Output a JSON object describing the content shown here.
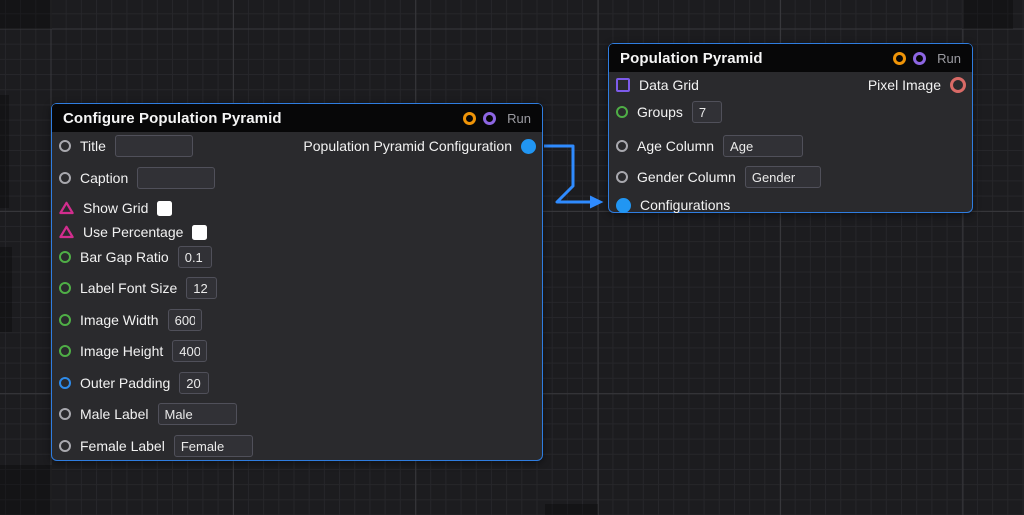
{
  "canvas": {
    "type": "node-graph-editor",
    "colors": {
      "canvas_background": "#1c1c1f",
      "grid_minor": "#26262a",
      "grid_major": "#38383c",
      "node_background": "#2a2a2d",
      "node_header": "#070708",
      "node_border": "#2f7de0",
      "wire": "#2f8bff",
      "port_gray": "#a8a8ae",
      "port_green": "#4fae46",
      "port_blue": "#2e8bea",
      "port_blue_filled": "#2196f3",
      "port_magenta": "#d22d8e",
      "port_orange": "#ef9408",
      "port_purple": "#8d66e3",
      "port_violet_square": "#7d5bea",
      "port_red": "#d96a66",
      "checkbox": "#ffffff"
    }
  },
  "nodes": [
    {
      "title": "Configure Population Pyramid",
      "run_label": "Run",
      "inputs": [
        {
          "label": "Title",
          "port": "gray-ring",
          "control": "text",
          "value": ""
        },
        {
          "label": "Caption",
          "port": "gray-ring",
          "control": "text",
          "value": ""
        },
        {
          "label": "Show Grid",
          "port": "magenta-triangle",
          "control": "checkbox",
          "checked": false
        },
        {
          "label": "Use Percentage",
          "port": "magenta-triangle",
          "control": "checkbox",
          "checked": false
        },
        {
          "label": "Bar Gap Ratio",
          "port": "green-ring",
          "control": "text",
          "value": "0.1"
        },
        {
          "label": "Label Font Size",
          "port": "green-ring",
          "control": "text",
          "value": "12"
        },
        {
          "label": "Image Width",
          "port": "green-ring",
          "control": "text",
          "value": "600"
        },
        {
          "label": "Image Height",
          "port": "green-ring",
          "control": "text",
          "value": "400"
        },
        {
          "label": "Outer Padding",
          "port": "blue-ring",
          "control": "text",
          "value": "20"
        },
        {
          "label": "Male Label",
          "port": "gray-ring",
          "control": "text",
          "value": "Male"
        },
        {
          "label": "Female Label",
          "port": "gray-ring",
          "control": "text",
          "value": "Female"
        }
      ],
      "outputs": [
        {
          "label": "Population Pyramid Configuration",
          "port": "blue-filled",
          "connected": true
        }
      ]
    },
    {
      "title": "Population Pyramid",
      "run_label": "Run",
      "inputs": [
        {
          "label": "Data Grid",
          "port": "violet-square",
          "control": "none"
        },
        {
          "label": "Groups",
          "port": "green-ring",
          "control": "text",
          "value": "7"
        },
        {
          "label": "Age Column",
          "port": "gray-ring",
          "control": "text",
          "value": "Age"
        },
        {
          "label": "Gender Column",
          "port": "gray-ring",
          "control": "text",
          "value": "Gender"
        },
        {
          "label": "Configurations",
          "port": "blue-filled",
          "control": "none",
          "connected": true
        }
      ],
      "outputs": [
        {
          "label": "Pixel Image",
          "port": "red-ring",
          "connected": false
        }
      ]
    }
  ],
  "connections": [
    {
      "from": "Configure Population Pyramid / Population Pyramid Configuration",
      "to": "Population Pyramid / Configurations"
    }
  ]
}
